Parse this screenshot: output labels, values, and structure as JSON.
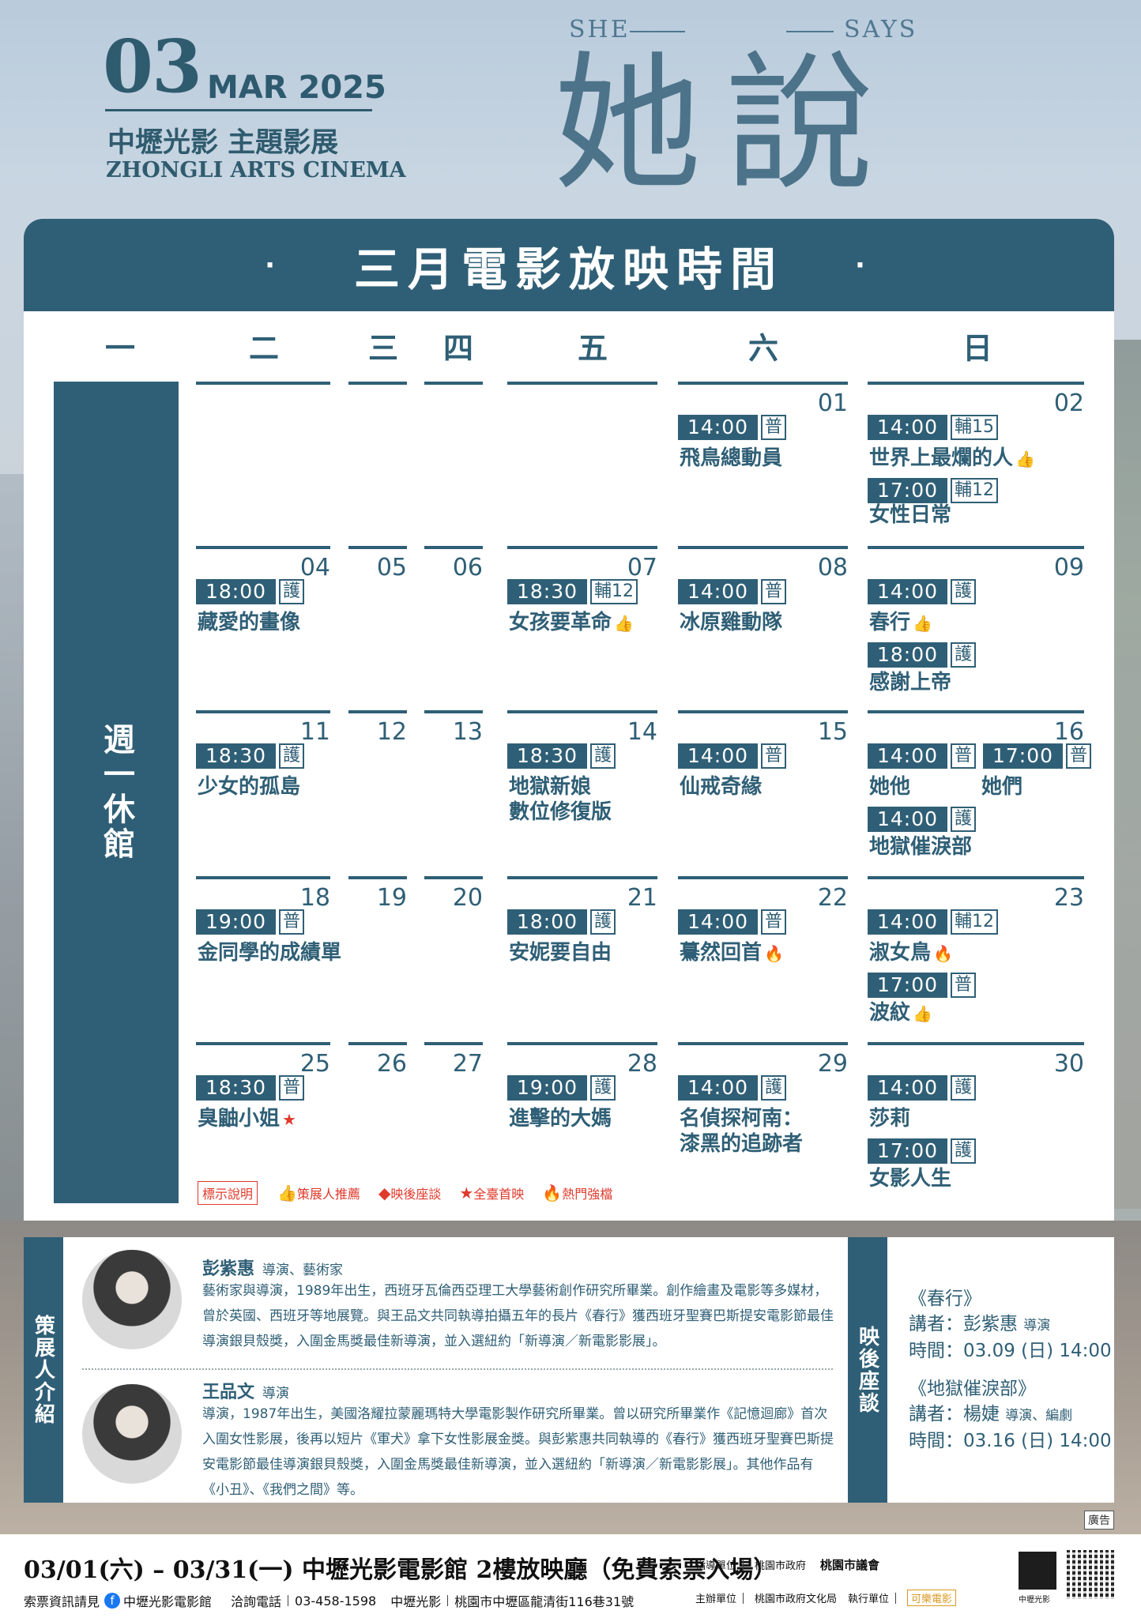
{
  "header": {
    "day": "03",
    "month_year": "MAR 2025",
    "title_cn": "中壢光影 主題影展",
    "title_en": "ZHONGLI ARTS CINEMA",
    "brand_left": "SHE",
    "brand_right": "SAYS",
    "brand_cn": "她說"
  },
  "schedule": {
    "title": "三月電影放映時間",
    "dot": "·",
    "weekdays": [
      "一",
      "二",
      "三",
      "四",
      "五",
      "六",
      "日"
    ],
    "closed": "週一休館",
    "cells": {
      "d01": {
        "num": "01",
        "s1": {
          "time": "14:00",
          "rate": "普",
          "film": "飛鳥總動員"
        }
      },
      "d02": {
        "num": "02",
        "s1": {
          "time": "14:00",
          "rate": "輔15",
          "film": "世界上最爛的人"
        },
        "s2": {
          "time": "17:00",
          "rate": "輔12",
          "film": "女性日常"
        }
      },
      "d04": {
        "num": "04",
        "s1": {
          "time": "18:00",
          "rate": "護",
          "film": "藏愛的畫像"
        }
      },
      "d05": {
        "num": "05"
      },
      "d06": {
        "num": "06"
      },
      "d07": {
        "num": "07",
        "s1": {
          "time": "18:30",
          "rate": "輔12",
          "film": "女孩要革命"
        }
      },
      "d08": {
        "num": "08",
        "s1": {
          "time": "14:00",
          "rate": "普",
          "film": "冰原雞動隊"
        }
      },
      "d09": {
        "num": "09",
        "s1": {
          "time": "14:00",
          "rate": "護",
          "film": "春行"
        },
        "s2": {
          "time": "18:00",
          "rate": "護",
          "film": "感謝上帝"
        }
      },
      "d11": {
        "num": "11",
        "s1": {
          "time": "18:30",
          "rate": "護",
          "film": "少女的孤島"
        }
      },
      "d12": {
        "num": "12"
      },
      "d13": {
        "num": "13"
      },
      "d14": {
        "num": "14",
        "s1": {
          "time": "18:30",
          "rate": "護",
          "film": "地獄新娘",
          "film2": "數位修復版"
        }
      },
      "d15": {
        "num": "15",
        "s1": {
          "time": "14:00",
          "rate": "普",
          "film": "仙戒奇緣"
        }
      },
      "d16": {
        "num": "16",
        "s1": {
          "time": "14:00",
          "rate": "普",
          "film": "她他"
        },
        "s1b": {
          "time": "17:00",
          "rate": "普",
          "film": "她們"
        },
        "s2": {
          "time": "14:00",
          "rate": "護",
          "film": "地獄催淚部"
        }
      },
      "d18": {
        "num": "18",
        "s1": {
          "time": "19:00",
          "rate": "普",
          "film": "金同學的成績單"
        }
      },
      "d19": {
        "num": "19"
      },
      "d20": {
        "num": "20"
      },
      "d21": {
        "num": "21",
        "s1": {
          "time": "18:00",
          "rate": "護",
          "film": "安妮要自由"
        }
      },
      "d22": {
        "num": "22",
        "s1": {
          "time": "14:00",
          "rate": "普",
          "film": "驀然回首"
        }
      },
      "d23": {
        "num": "23",
        "s1": {
          "time": "14:00",
          "rate": "輔12",
          "film": "淑女鳥"
        },
        "s2": {
          "time": "17:00",
          "rate": "普",
          "film": "波紋"
        }
      },
      "d25": {
        "num": "25",
        "s1": {
          "time": "18:30",
          "rate": "普",
          "film": "臭鼬小姐"
        }
      },
      "d26": {
        "num": "26"
      },
      "d27": {
        "num": "27"
      },
      "d28": {
        "num": "28",
        "s1": {
          "time": "19:00",
          "rate": "護",
          "film": "進擊的大媽"
        }
      },
      "d29": {
        "num": "29",
        "s1": {
          "time": "14:00",
          "rate": "護",
          "film": "名偵探柯南：",
          "film2": "漆黑的追跡者"
        }
      },
      "d30": {
        "num": "30",
        "s1": {
          "time": "14:00",
          "rate": "護",
          "film": "莎莉"
        },
        "s2": {
          "time": "17:00",
          "rate": "護",
          "film": "女影人生"
        }
      }
    },
    "legend": {
      "label": "標示說明",
      "curator": "策展人推薦",
      "talk": "映後座談",
      "premiere": "全臺首映",
      "hot": "熱門強檔"
    }
  },
  "curators": {
    "tab": "策展人介紹",
    "p1": {
      "name": "彭紫惠",
      "role": "導演、藝術家",
      "bio": "藝術家與導演，1989年出生，西班牙瓦倫西亞理工大學藝術創作研究所畢業。創作繪畫及電影等多媒材，曾於英國、西班牙等地展覽。與王品文共同執導拍攝五年的長片《春行》獲西班牙聖賽巴斯提安電影節最佳導演銀貝殼獎，入圍金馬獎最佳新導演，並入選紐約「新導演／新電影影展」。"
    },
    "p2": {
      "name": "王品文",
      "role": "導演",
      "bio": "導演，1987年出生，美國洛耀拉蒙麗瑪特大學電影製作研究所畢業。曾以研究所畢業作《記憶迴廊》首次入圍女性影展，後再以短片《軍犬》拿下女性影展金獎。與彭紫惠共同執導的《春行》獲西班牙聖賽巴斯提安電影節最佳導演銀貝殼獎，入圍金馬獎最佳新導演，並入選紐約「新導演／新電影影展」。其他作品有《小丑》、《我們之間》等。"
    }
  },
  "talks": {
    "tab": "映後座談",
    "t1": {
      "film": "《春行》",
      "guest": "講者：彭紫惠",
      "guest_role": "導演",
      "time": "時間：03.09 (日) 14:00"
    },
    "t2": {
      "film": "《地獄催淚部》",
      "guest": "講者：楊婕",
      "guest_role": "導演、編劇",
      "time": "時間：03.16 (日) 14:00"
    }
  },
  "ad_tag": "廣告",
  "footer": {
    "main": "03/01(六) – 03/31(一) 中壢光影電影館 2樓放映廳（免費索票入場）",
    "ticket": "索票資訊請見",
    "fb": "中壢光影電影館",
    "phone_label": "洽詢電話",
    "phone": "03-458-1598",
    "venue": "中壢光影",
    "address": "桃園市中壢區龍清街116巷31號",
    "guide_label": "指導單位",
    "guide1": "桃園市政府",
    "guide2": "桃園市議會",
    "host_label": "主辦單位",
    "host": "桃園市政府文化局",
    "exec_label": "執行單位",
    "exec": "可樂電影",
    "cinema_logo": "中壢光影"
  },
  "colors": {
    "primary": "#2f5f76",
    "accent": "#e03a2c",
    "panel": "#ffffff"
  }
}
